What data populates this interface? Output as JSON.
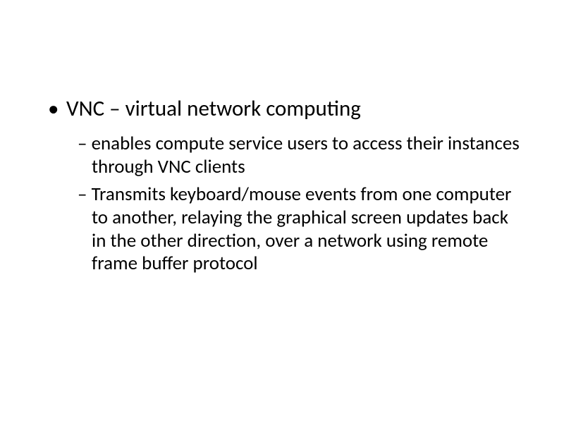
{
  "bullets": {
    "main": {
      "marker": "•",
      "text": "VNC – virtual network computing"
    },
    "subs": [
      {
        "marker": "–",
        "text": "enables compute service users to access their instances through VNC clients"
      },
      {
        "marker": "–",
        "text": "Transmits  keyboard/mouse events from one computer to another, relaying the graphical screen updates back in the other direction, over a network using remote frame buffer protocol"
      }
    ]
  }
}
